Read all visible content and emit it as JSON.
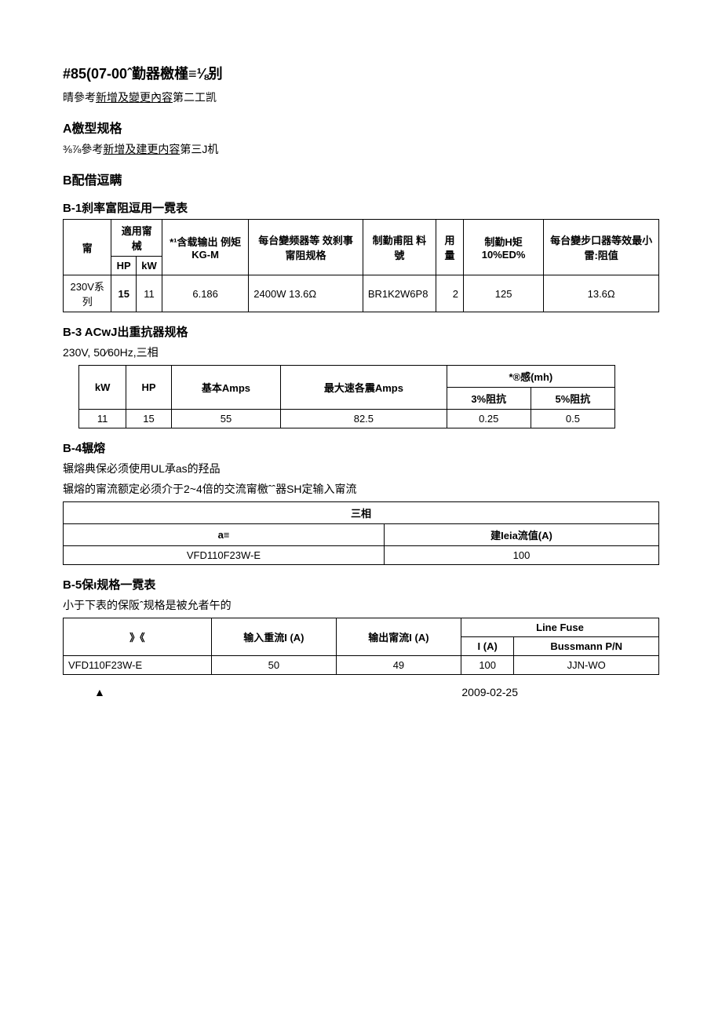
{
  "h85": {
    "title": "#85(07-00ˆ勤器檄槿≡⅛别",
    "ref_prefix": "晴參考",
    "ref_link": "新增及變更內容",
    "ref_suffix": "第二工凯"
  },
  "A": {
    "title": "A檄型规格",
    "ref_prefix": "⅜⅞參考",
    "ref_link": "新增及建更内容",
    "ref_suffix": "第三J机"
  },
  "B": {
    "title": "B配借逗瞒"
  },
  "B1": {
    "title": "B-1刹率富阻逗用一霓表",
    "headers": {
      "c0": "甯",
      "c1_top": "適用甯械",
      "c1a": "HP",
      "c1b": "kW",
      "c2": "*¹含载输出 例矩KG-M",
      "c3": "每台變频器等 效刹事甯阻规格",
      "c4": "制勤甫阻 料號",
      "c5": "用量",
      "c6": "制勤H矩10%ED%",
      "c7": "每台變步口器等效最小 雷:阻值"
    },
    "row": {
      "c0": "230V系列",
      "c1a": "15",
      "c1b": "11",
      "c2": "6.186",
      "c3": "2400W 13.6Ω",
      "c4": "BR1K2W6P8",
      "c5": "2",
      "c6": "125",
      "c7": "13.6Ω"
    }
  },
  "B3": {
    "title": "B-3 ACwJ出重抗器规格",
    "subtitle": "230V, 50⁄60Hz,三相",
    "headers": {
      "kw": "kW",
      "hp": "HP",
      "base": "基本Amps",
      "max": "最大速各震Amps",
      "ind": "*®感(mh)",
      "z3": "3%阻抗",
      "z5": "5%阻抗"
    },
    "row": {
      "kw": "11",
      "hp": "15",
      "base": "55",
      "max": "82.5",
      "z3": "0.25",
      "z5": "0.5"
    }
  },
  "B4": {
    "title": "B-4辗熔",
    "p1": "辗熔典保必须使用UL承as的羟品",
    "p2": "辗熔的甯流额定必须介于2~4倍的交流甯檄ˆˆ器SH定输入甯流",
    "headers": {
      "top": "三相",
      "left": "a≡",
      "right": "建Ieia流值(A)"
    },
    "row": {
      "left": "VFD110F23W-E",
      "right": "100"
    }
  },
  "B5": {
    "title": "B-5保ı规格一霓表",
    "p1": "小于下表的保阪ˆ规格是被允者午的",
    "headers": {
      "model": "》《",
      "iin": "输入重流I (A)",
      "iout": "输出甯流I (A)",
      "linefuse": "Line Fuse",
      "ia": "I (A)",
      "bpn": "Bussmann P/N"
    },
    "row": {
      "model": "VFD110F23W-E",
      "iin": "50",
      "iout": "49",
      "ia": "100",
      "bpn": "JJN-WO"
    }
  },
  "footer": {
    "tri": "▲",
    "date": "2009-02-25"
  }
}
